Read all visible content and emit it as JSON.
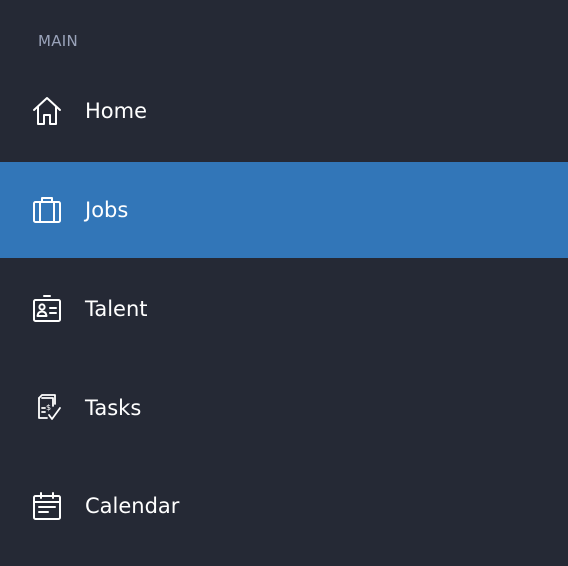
{
  "sidebar": {
    "section_label": "MAIN",
    "active_color": "#3276b8",
    "background_color": "#252935",
    "items": [
      {
        "label": "Home",
        "icon": "home-icon",
        "active": false
      },
      {
        "label": "Jobs",
        "icon": "briefcase-icon",
        "active": true
      },
      {
        "label": "Talent",
        "icon": "id-card-icon",
        "active": false
      },
      {
        "label": "Tasks",
        "icon": "document-check-icon",
        "active": false
      },
      {
        "label": "Calendar",
        "icon": "calendar-icon",
        "active": false
      }
    ]
  }
}
